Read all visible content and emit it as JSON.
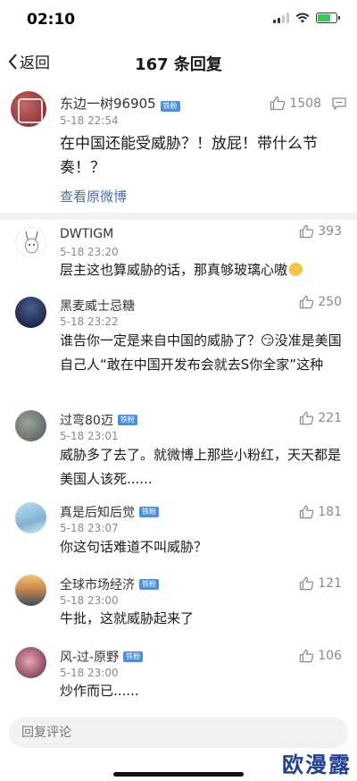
{
  "status_bar": {
    "time": "02:10"
  },
  "nav": {
    "back_label": "返回",
    "title": "167 条回复"
  },
  "post": {
    "author": "东边一树96905",
    "badge": "铁粉",
    "time": "5-18 22:54",
    "text": "在中国还能受威胁？！放屁！带什么节奏！？",
    "link": "查看原微博",
    "likes": "1508"
  },
  "replies": [
    {
      "name": "DWTIGM",
      "badge": "",
      "time": "5-18 23:20",
      "text": "层主这也算威胁的话，那真够玻璃心嗷",
      "emoji": true,
      "likes": "393"
    },
    {
      "name": "黑麦威士忌糖",
      "badge": "",
      "time": "5-18 23:22",
      "text": "谁告你一定是来自中国的威胁了？😏没准是美国自己人“敢在中国开发布会就去S你全家”这种",
      "emoji": false,
      "likes": "250"
    },
    {
      "name": "过弯80迈",
      "badge": "铁粉",
      "time": "5-18 23:01",
      "text": "威胁多了去了。就微博上那些小粉红，天天都是美国人该死......",
      "emoji": false,
      "likes": "221"
    },
    {
      "name": "真是后知后觉",
      "badge": "铁粉",
      "time": "5-18 23:07",
      "text": "你这句话难道不叫威胁？",
      "emoji": false,
      "likes": "181"
    },
    {
      "name": "全球市场经济",
      "badge": "铁粉",
      "time": "5-18 23:00",
      "text": "牛批，这就威胁起来了",
      "emoji": false,
      "likes": "121"
    },
    {
      "name": "风-过-原野",
      "badge": "铁粉",
      "time": "5-18 23:00",
      "text": "炒作而已......",
      "emoji": false,
      "likes": "106"
    }
  ],
  "comment_input": {
    "placeholder": "回复评论"
  },
  "watermark": "欧漫露"
}
